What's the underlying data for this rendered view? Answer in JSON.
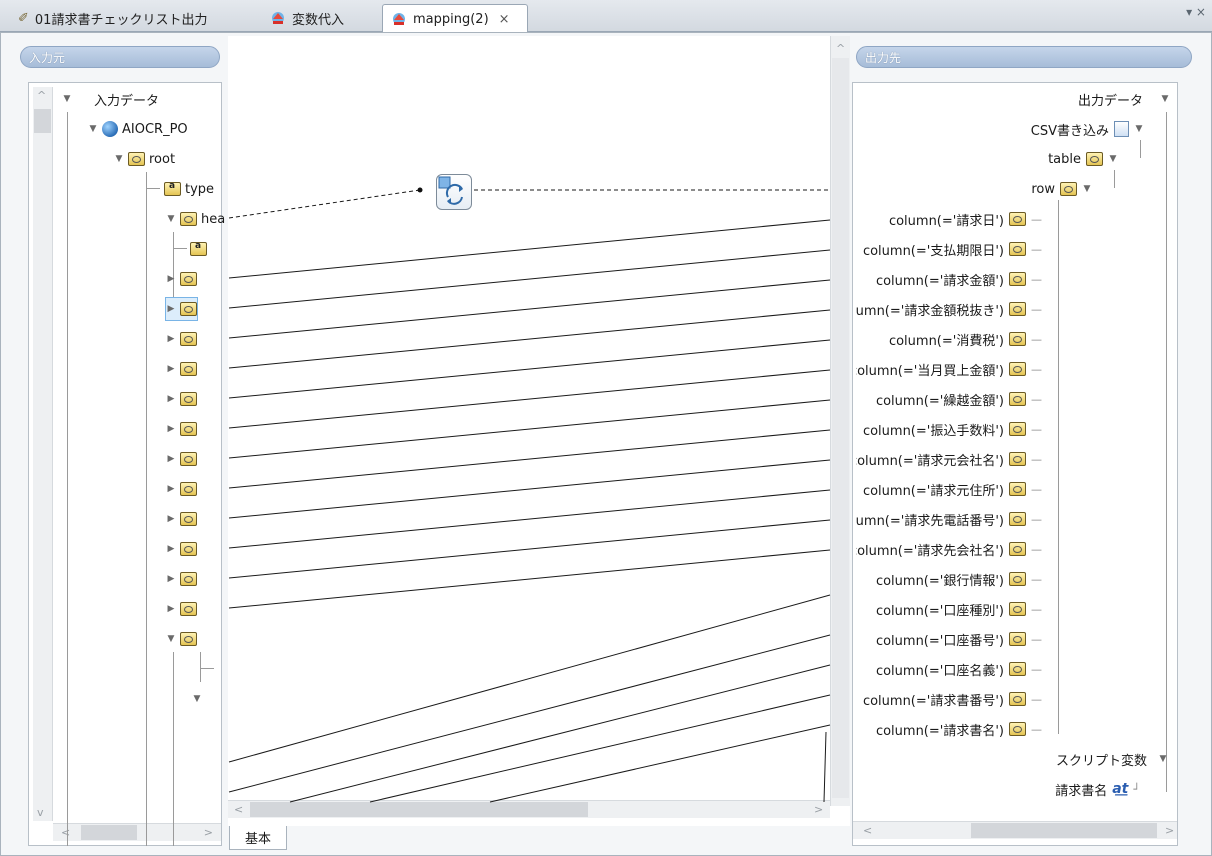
{
  "tabs": [
    {
      "label": "01請求書チェックリスト出力",
      "icon": "pencil-icon",
      "active": false
    },
    {
      "label": "変数代入",
      "icon": "mapping-icon",
      "active": false
    },
    {
      "label": "mapping(2)",
      "icon": "mapping-icon",
      "active": true,
      "close": "×"
    }
  ],
  "window_controls": "▾ ×",
  "input_pane": {
    "title": "入力元",
    "root_label": "入力データ",
    "items": [
      {
        "label": "AIOCR_PO"
      },
      {
        "label": "root"
      },
      {
        "label": "type"
      },
      {
        "label": "hea"
      }
    ]
  },
  "output_pane": {
    "title": "出力先",
    "root_label": "出力データ",
    "csv_label": "CSV書き込み",
    "table_label": "table",
    "row_label": "row",
    "columns": [
      "column(='請求日')",
      "column(='支払期限日')",
      "column(='請求金額')",
      "column(='請求金額税抜き')",
      "column(='消費税')",
      "column(='当月買上金額')",
      "column(='繰越金額')",
      "column(='振込手数料')",
      "column(='請求元会社名')",
      "column(='請求元住所')",
      "column(='請求先電話番号')",
      "column(='請求先会社名')",
      "column(='銀行情報')",
      "column(='口座種別')",
      "column(='口座番号')",
      "column(='口座名義')",
      "column(='請求書番号')",
      "column(='請求書名')"
    ],
    "script_var_label": "スクリプト変数",
    "var_item": "請求書名"
  },
  "bottom_tab": "基本",
  "colors": {
    "header_blue": "#a6bcd8",
    "selection": "#dcedfb",
    "line": "#000000"
  }
}
